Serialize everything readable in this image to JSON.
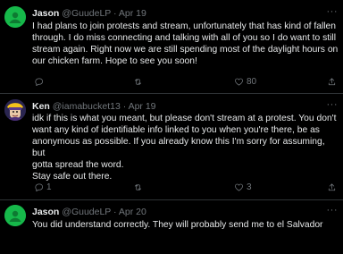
{
  "tweets": [
    {
      "name": "Jason",
      "handle": "@GuudeLP",
      "sep": "·",
      "date": "Apr 19",
      "text": "I had plans to join protests and stream, unfortunately that has kind of fallen\nthrough. I do miss connecting and talking with all of you so I do want to still\nstream again. Right now we are still spending most of the daylight hours on\nour chicken farm. Hope to see you soon!",
      "replies": "",
      "retweets": "",
      "likes": "80",
      "avatar": "green-circle-avatar"
    },
    {
      "name": "Ken",
      "handle": "@iamabucket13",
      "sep": "·",
      "date": "Apr 19",
      "text": "idk if this is what you meant, but please don't stream at a protest. You don't\nwant any kind of identifiable info linked to you when you're there, be as\nanonymous as possible. If you already know this I'm sorry for assuming, but\ngotta spread the word.\nStay safe out there.",
      "replies": "1",
      "retweets": "",
      "likes": "3",
      "avatar": "cartoon-character-avatar"
    },
    {
      "name": "Jason",
      "handle": "@GuudeLP",
      "sep": "·",
      "date": "Apr 20",
      "text": "You did understand correctly. They will probably send me to el Salvador",
      "avatar": "green-circle-avatar"
    }
  ],
  "more_label": "···",
  "colors": {
    "background": "#000000",
    "text": "#e7e9ea",
    "muted": "#71767b",
    "divider": "#2f3336",
    "avatar_green": "#16b84a"
  }
}
